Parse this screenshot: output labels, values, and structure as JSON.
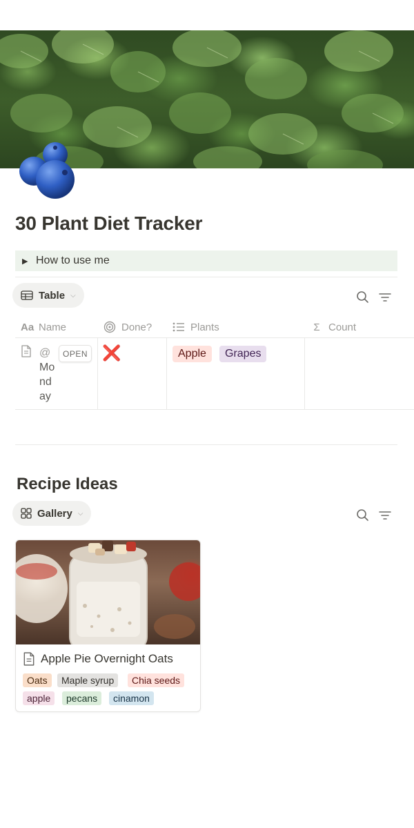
{
  "page": {
    "title": "30 Plant Diet Tracker",
    "icon": "blueberries-icon",
    "cover": "lettuce-leaves-cover"
  },
  "toggle": {
    "label": "How to use me"
  },
  "table_view": {
    "view_label": "Table",
    "columns": [
      {
        "label": "Name",
        "icon": "Aa"
      },
      {
        "label": "Done?",
        "icon": "target-icon"
      },
      {
        "label": "Plants",
        "icon": "list-icon"
      },
      {
        "label": "Count",
        "icon": "Σ"
      }
    ],
    "rows": [
      {
        "name": "@ Monday",
        "name_prefix": "@",
        "name_word": "Monday",
        "open_label": "OPEN",
        "done": "❌",
        "plants": [
          "Apple",
          "Grapes"
        ],
        "count": ""
      }
    ]
  },
  "gallery_section": {
    "heading": "Recipe Ideas",
    "view_label": "Gallery",
    "cards": [
      {
        "title": "Apple Pie Overnight Oats",
        "tags": [
          "Oats",
          "Maple syrup",
          "Chia seeds",
          "apple",
          "pecans",
          "cinamon"
        ]
      }
    ]
  },
  "colors": {
    "toggle_bg": "#edf3ec",
    "tag_apple": "#ffe2dd",
    "tag_grapes": "#e8deee",
    "tag_oats": "#fadec9",
    "tag_maple": "#e3e2e0",
    "tag_chia": "#ffe2dd",
    "tag_apple_lower": "#f5e0e9",
    "tag_pecans": "#dbeddb",
    "tag_cinamon": "#d3e5ef",
    "done_red": "#e03e3e"
  }
}
